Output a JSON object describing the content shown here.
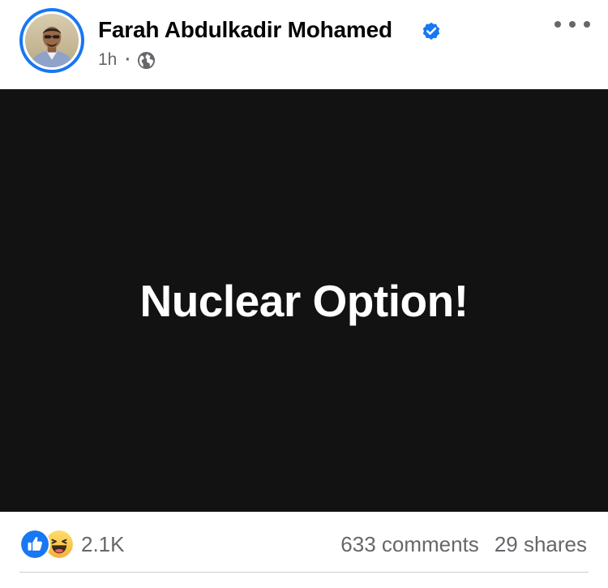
{
  "post": {
    "author": {
      "name": "Farah Abdulkadir Mohamed",
      "verified": true,
      "avatar_icon": "profile-photo"
    },
    "meta": {
      "time": "1h",
      "separator": "·",
      "audience_icon": "globe-icon"
    },
    "more_icon": "more-options-icon",
    "content": {
      "text": "Nuclear Option!",
      "background": "#121212",
      "text_color": "#ffffff"
    },
    "reactions": {
      "icons": [
        "like-icon",
        "haha-icon"
      ],
      "count": "2.1K"
    },
    "engagement": {
      "comments": "633 comments",
      "shares": "29 shares"
    },
    "colors": {
      "brand": "#1877f2",
      "secondary_text": "#65676b",
      "primary_text": "#050505"
    }
  }
}
